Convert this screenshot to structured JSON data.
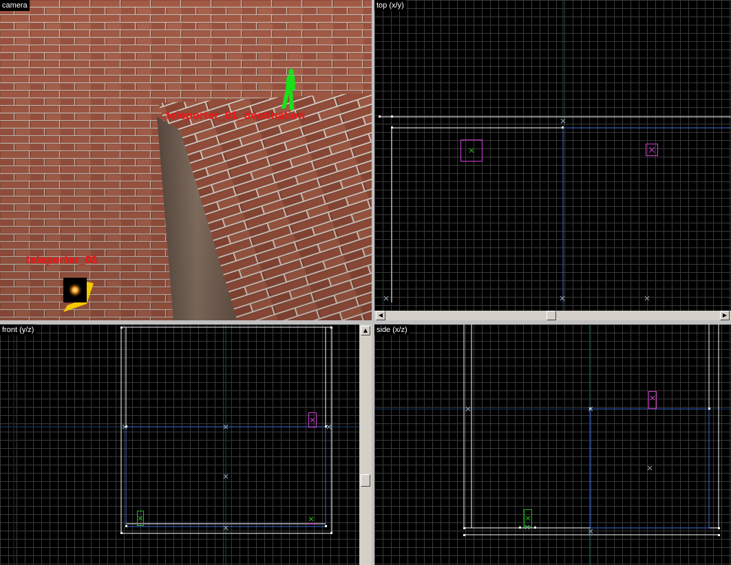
{
  "viewports": {
    "camera": {
      "title": "camera"
    },
    "top": {
      "title": "top (x/y)"
    },
    "front": {
      "title": "front (y/z)"
    },
    "side": {
      "title": "side (x/z)"
    }
  },
  "camera_labels": {
    "destination": "teleporter_01_destination",
    "source": "teleporter_01"
  },
  "icons": {
    "player_start": "player-figure-icon",
    "light": "light-entity-icon"
  },
  "colors": {
    "grid_major": "#3a3a3a",
    "grid_minor": "#1c1c1c",
    "brush_white": "#ffffff",
    "brush_blue": "#3b6fd6",
    "entity_magenta": "#d040d0",
    "entity_green": "#20c020",
    "label_red": "#ff1a1a"
  }
}
